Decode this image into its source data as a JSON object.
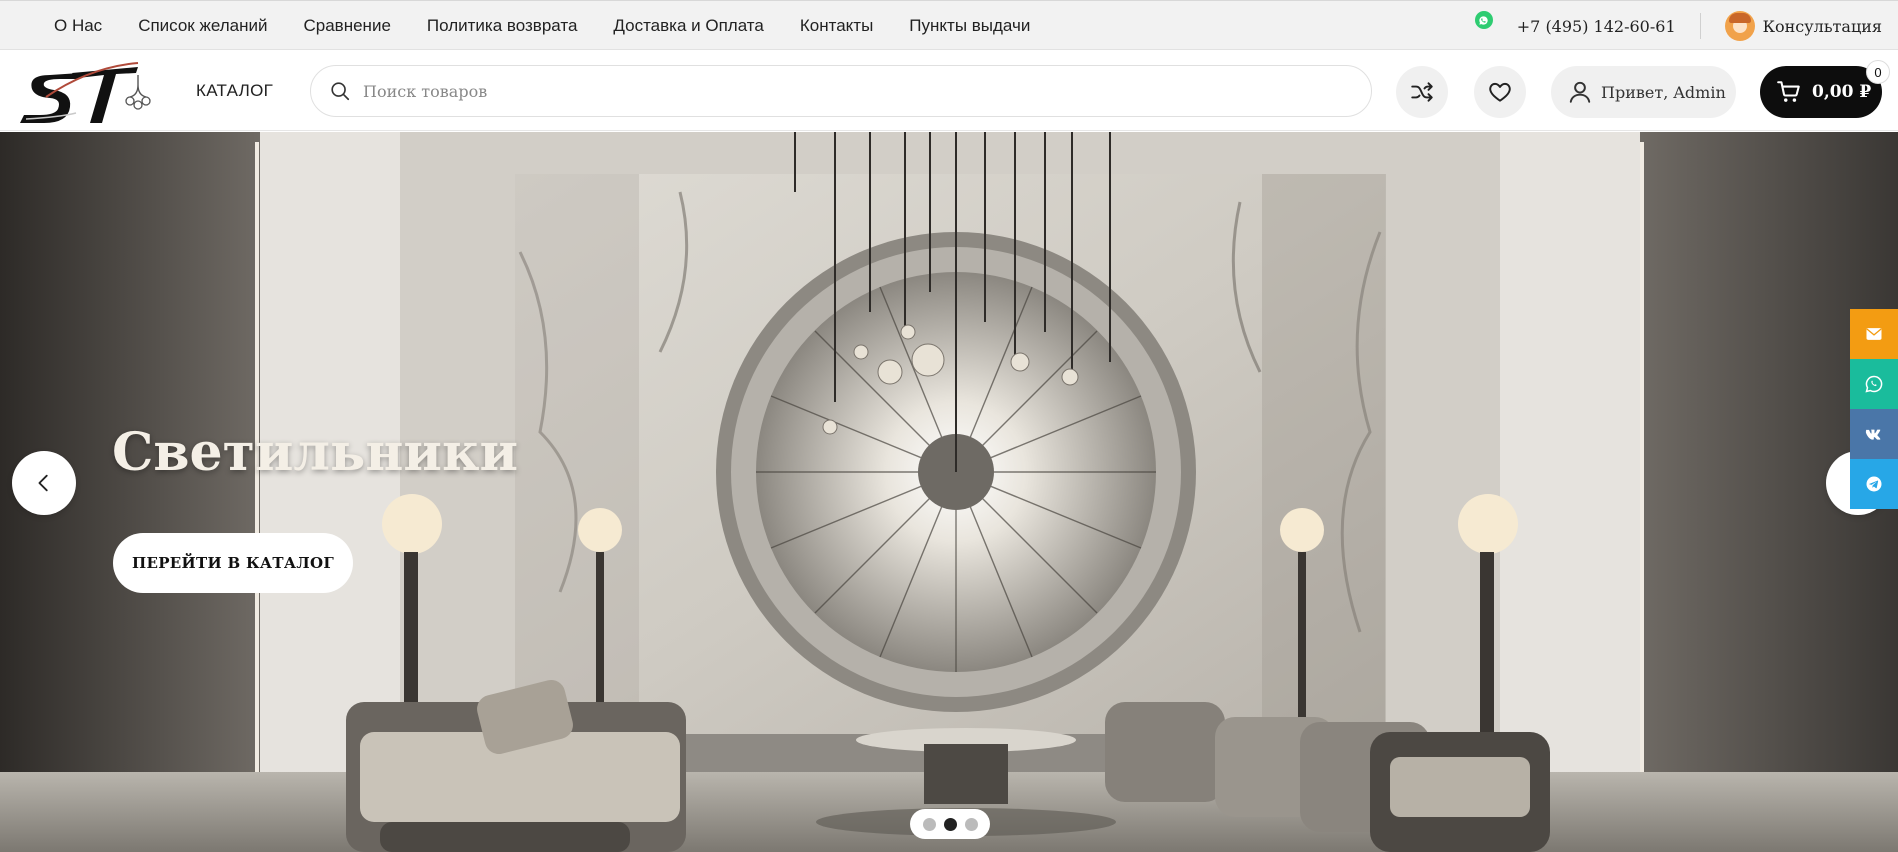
{
  "topbar": {
    "nav": [
      "О Нас",
      "Список желаний",
      "Сравнение",
      "Политика возврата",
      "Доставка и Оплата",
      "Контакты",
      "Пункты выдачи"
    ],
    "phone": "+7 (495) 142-60-61",
    "consult_label": "Консультация"
  },
  "header": {
    "catalog_label": "КАТАЛОГ",
    "search_placeholder": "Поиск товаров",
    "account_label": "Привет, Admin",
    "cart_total": "0,00 ₽",
    "cart_count": "0"
  },
  "hero": {
    "title": "Светильники",
    "button_label": "ПЕРЕЙТИ В КАТАЛОГ",
    "slides_total": 3,
    "active_slide": 2
  },
  "social": [
    {
      "name": "email-icon",
      "color": "#f39c12"
    },
    {
      "name": "whatsapp-icon",
      "color": "#1abc9c"
    },
    {
      "name": "vk-icon",
      "color": "#4a76a8"
    },
    {
      "name": "telegram-icon",
      "color": "#27a7e7"
    }
  ],
  "colors": {
    "cart_bg": "#0d0d0d",
    "whatsapp_green": "#2ecc71"
  }
}
